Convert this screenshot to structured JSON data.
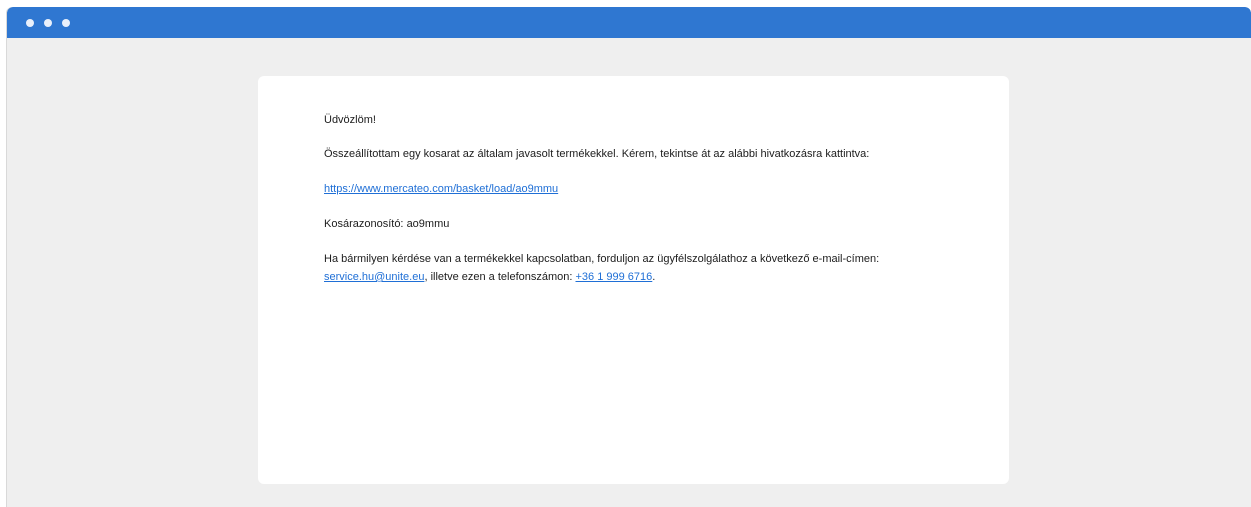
{
  "window": {
    "controls": [
      "close-dot",
      "minimize-dot",
      "maximize-dot"
    ]
  },
  "email": {
    "greeting": "Üdvözlöm!",
    "intro": "Összeállítottam egy kosarat az általam javasolt termékekkel. Kérem, tekintse át az alábbi hivatkozásra kattintva:",
    "basket_link": "https://www.mercateo.com/basket/load/ao9mmu",
    "basket_id_label": "Kosárazonosító:",
    "basket_id_value": "ao9mmu",
    "contact_text_before_email": "Ha bármilyen kérdése van a termékekkel kapcsolatban, forduljon az ügyfélszolgálathoz a következő e-mail-címen:",
    "contact_email": "service.hu@unite.eu",
    "contact_text_between": ", illetve ezen a telefonszámon:",
    "contact_phone": "+36 1 999 6716",
    "contact_text_end": "."
  },
  "colors": {
    "titlebar": "#2f77d1",
    "background": "#efefef",
    "link": "#1f6fd6"
  }
}
